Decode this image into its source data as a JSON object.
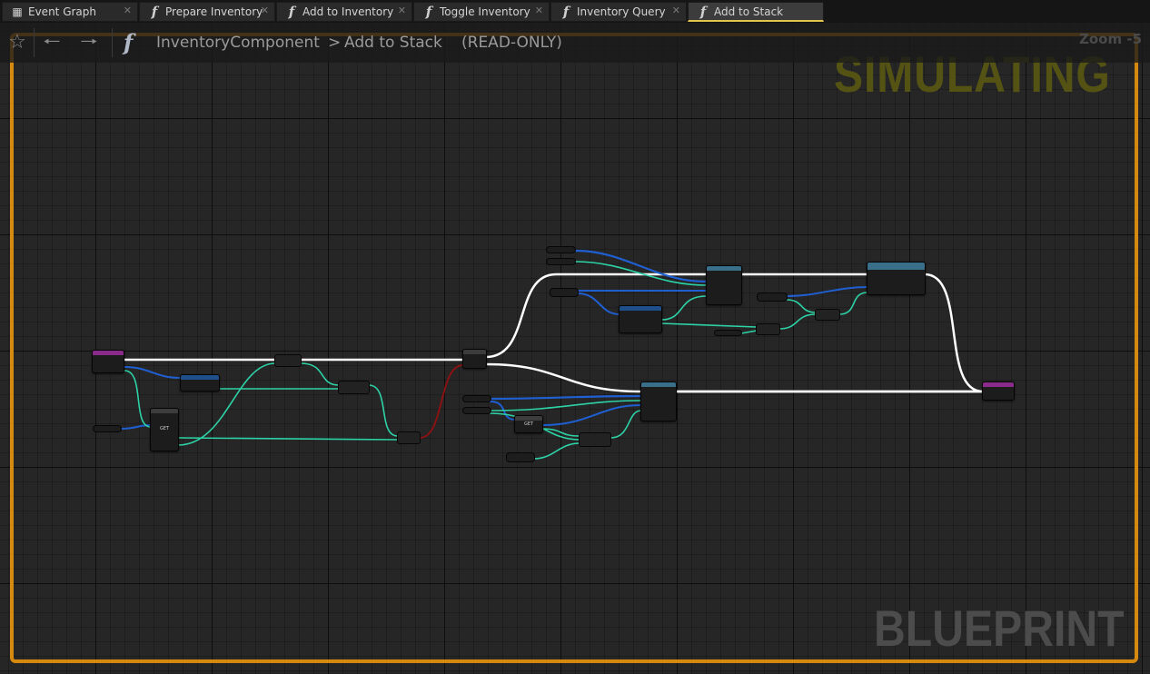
{
  "tabs": [
    {
      "label": "Event Graph",
      "icon": "event-graph-icon"
    },
    {
      "label": "Prepare Inventory",
      "icon": "function-icon"
    },
    {
      "label": "Add to Inventory",
      "icon": "function-icon"
    },
    {
      "label": "Toggle Inventory",
      "icon": "function-icon"
    },
    {
      "label": "Inventory Query",
      "icon": "function-icon"
    },
    {
      "label": "Add to Stack",
      "icon": "function-icon",
      "active": true
    }
  ],
  "toolbar": {
    "breadcrumb": [
      "InventoryComponent",
      "Add to Stack"
    ],
    "separator": ">",
    "mode": "(READ-ONLY)",
    "zoom": "Zoom -5"
  },
  "overlay": {
    "status": "SIMULATING",
    "watermark": "BLUEPRINT"
  },
  "nodes": {
    "get_label_1": "GET",
    "get_label_2": "GET"
  },
  "colors": {
    "border": "#d58a0f",
    "exec_wire": "#ffffff",
    "int_wire": "#2dd3a6",
    "struct_wire": "#1f5fd1",
    "bool_wire": "#8a1212",
    "function_entry_header": "#8a2a8a",
    "function_call_header": "#3a6f8a",
    "tab_highlight": "#e4c64a"
  }
}
